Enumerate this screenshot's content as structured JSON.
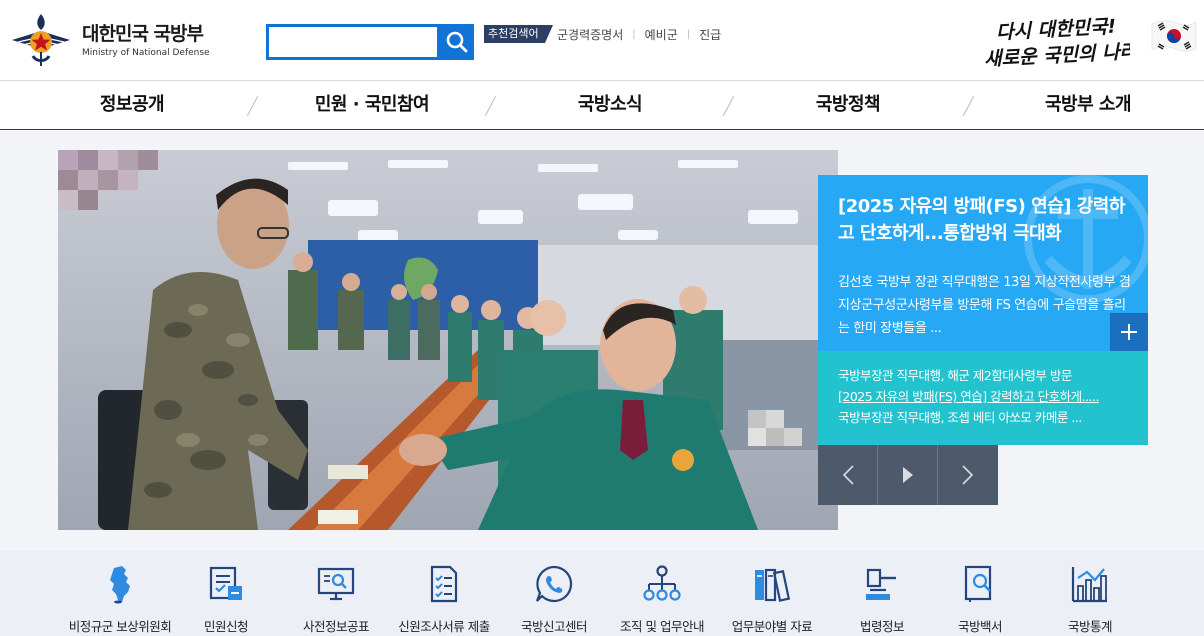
{
  "header": {
    "logo_ko": "대한민국 국방부",
    "logo_en": "Ministry of National Defense",
    "search_placeholder": "",
    "recommended_tag": "추천검색어",
    "top_links": [
      "군경력증명서",
      "예비군",
      "진급"
    ],
    "slogan_line1": "다시 대한민국!",
    "slogan_line2": "새로운 국민의 나라"
  },
  "nav": {
    "items": [
      "정보공개",
      "민원 · 국민참여",
      "국방소식",
      "국방정책",
      "국방부 소개"
    ]
  },
  "feature": {
    "title": "[2025 자유의 방패(FS) 연습] 강력하고 단호하게...통합방위 극대화",
    "desc": "김선호 국방부 장관 직무대행은 13일 지상작전사령부 겸 지상군구성군사령부를 방문해 FS 연습에 구슬땀을 흘리는 한미 장병들을 ..."
  },
  "news_list": [
    "국방부장관 직무대행, 해군 제2함대사령부 방문",
    "[2025 자유의 방패(FS) 연습] 강력하고 단호하게.....",
    "국방부장관 직무대행, 조셉 베티 아쏘모 카메룬 ..."
  ],
  "quick_menu": [
    {
      "label": "비정규군 보상위원회",
      "icon": "korea-map-icon"
    },
    {
      "label": "민원신청",
      "icon": "form-document-icon"
    },
    {
      "label": "사전정보공표",
      "icon": "monitor-search-icon"
    },
    {
      "label": "신원조사서류 제출",
      "icon": "checklist-document-icon"
    },
    {
      "label": "국방신고센터",
      "icon": "phone-bubble-icon"
    },
    {
      "label": "조직 및 업무안내",
      "icon": "org-chart-icon"
    },
    {
      "label": "업무분야별 자료",
      "icon": "binders-icon"
    },
    {
      "label": "법령정보",
      "icon": "gavel-icon"
    },
    {
      "label": "국방백서",
      "icon": "book-search-icon"
    },
    {
      "label": "국방통계",
      "icon": "bar-chart-icon"
    }
  ],
  "colors": {
    "accent_blue": "#1273d6",
    "feature_blue": "#27a8f5",
    "list_teal": "#23c2cf",
    "nav_line": "#1b3a6b",
    "icon_navy": "#24457e",
    "icon_blue": "#2f8be0"
  }
}
